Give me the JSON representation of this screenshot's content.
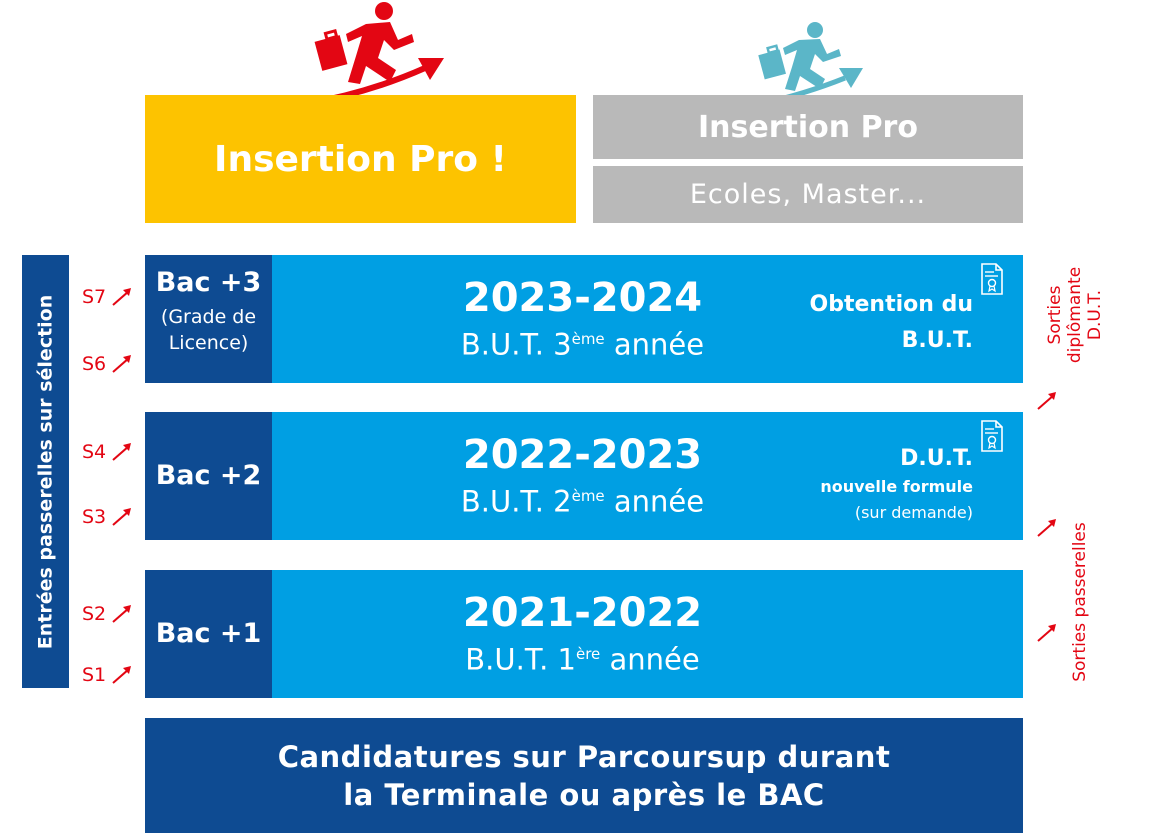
{
  "top": {
    "left_box": "Insertion Pro !",
    "right_box_top": "Insertion Pro",
    "right_box_bottom": "Ecoles, Master..."
  },
  "left_bar": "Entrées passerelles sur sélection",
  "semesters": [
    "S7",
    "S6",
    "S4",
    "S3",
    "S2",
    "S1"
  ],
  "rows": [
    {
      "bac": "Bac +3",
      "bac_sub_1": "(Grade de",
      "bac_sub_2": "Licence)",
      "year": "2023-2024",
      "level_prefix": "B.U.T. 3",
      "level_sup": "ème",
      "level_suffix": " année",
      "right_1": "Obtention du",
      "right_2": "B.U.T."
    },
    {
      "bac": "Bac +2",
      "year": "2022-2023",
      "level_prefix": "B.U.T. 2",
      "level_sup": "ème",
      "level_suffix": " année",
      "right_1": "D.U.T.",
      "right_2": "nouvelle formule",
      "right_3": "(sur demande)"
    },
    {
      "bac": "Bac +1",
      "year": "2021-2022",
      "level_prefix": "B.U.T. 1",
      "level_sup": "ère",
      "level_suffix": " année"
    }
  ],
  "right_labels": {
    "sorties_dut_1": "Sorties",
    "sorties_dut_2": "diplômante",
    "sorties_dut_3": "D.U.T.",
    "sorties_passerelles": "Sorties passerelles"
  },
  "bottom": {
    "line1": "Candidatures sur Parcoursup durant",
    "line2": "la Terminale ou après le BAC"
  },
  "colors": {
    "yellow": "#fdc300",
    "grey": "#b9b9b9",
    "light_blue": "#009fe3",
    "dark_blue": "#0e4b92",
    "red": "#e30613",
    "teal_runner": "#5bb6c8"
  }
}
